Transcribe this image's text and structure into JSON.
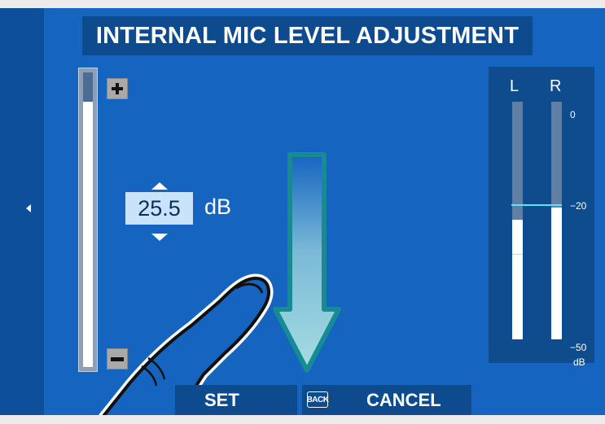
{
  "title": "INTERNAL MIC LEVEL ADJUSTMENT",
  "level": {
    "value": "25.5",
    "unit": "dB",
    "slider_fraction": 0.9
  },
  "meter": {
    "left_label": "L",
    "right_label": "R",
    "tick_0": "0",
    "tick_20": "−20",
    "tick_50": "−50",
    "tick_unit": "dB"
  },
  "buttons": {
    "set_label": "SET",
    "back_icon_label": "BACK",
    "cancel_label": "CANCEL"
  },
  "colors": {
    "screen_bg": "#1565c0",
    "panel_bg": "#0d4a8e",
    "value_box": "#c8e3fb",
    "reference_line": "#5ce1ff",
    "swipe_arrow": "#8fd4d4"
  },
  "icons": {
    "left_nav": "triangle-left-icon",
    "increase": "plus-icon",
    "decrease": "minus-icon",
    "value_up": "triangle-up-icon",
    "value_down": "triangle-down-icon",
    "gesture": "swipe-down-arrow-icon",
    "hand": "finger-icon",
    "back": "back-icon"
  }
}
